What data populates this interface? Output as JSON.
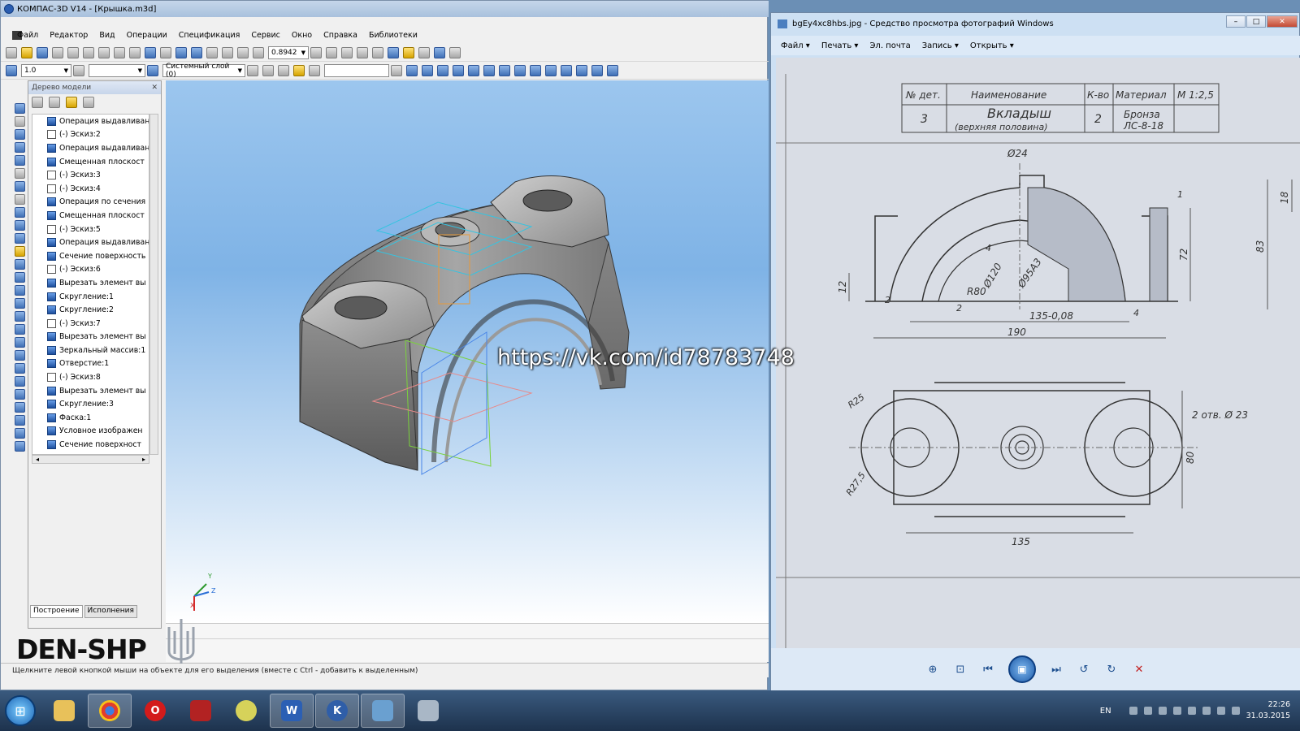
{
  "kompas": {
    "title": "КОМПАС-3D V14 - [Крышка.m3d]",
    "menu": [
      "Файл",
      "Редактор",
      "Вид",
      "Операции",
      "Спецификация",
      "Сервис",
      "Окно",
      "Справка",
      "Библиотеки"
    ],
    "zoom": "0.8942",
    "step": "1.0",
    "layer": "Системный слой (0)",
    "tree_title": "Дерево модели",
    "tree": [
      {
        "label": "Операция выдавливан",
        "type": "op"
      },
      {
        "label": "(-) Эскиз:2",
        "type": "sketch"
      },
      {
        "label": "Операция выдавливан",
        "type": "op"
      },
      {
        "label": "Смещенная плоскост",
        "type": "op"
      },
      {
        "label": "(-) Эскиз:3",
        "type": "sketch"
      },
      {
        "label": "(-) Эскиз:4",
        "type": "sketch"
      },
      {
        "label": "Операция по сечения",
        "type": "op"
      },
      {
        "label": "Смещенная плоскост",
        "type": "op"
      },
      {
        "label": "(-) Эскиз:5",
        "type": "sketch"
      },
      {
        "label": "Операция выдавливан",
        "type": "op"
      },
      {
        "label": "Сечение поверхность",
        "type": "op"
      },
      {
        "label": "(-) Эскиз:6",
        "type": "sketch"
      },
      {
        "label": "Вырезать элемент вы",
        "type": "op"
      },
      {
        "label": "Скругление:1",
        "type": "op"
      },
      {
        "label": "Скругление:2",
        "type": "op"
      },
      {
        "label": "(-) Эскиз:7",
        "type": "sketch"
      },
      {
        "label": "Вырезать элемент вы",
        "type": "op"
      },
      {
        "label": "Зеркальный массив:1",
        "type": "op"
      },
      {
        "label": "Отверстие:1",
        "type": "op"
      },
      {
        "label": "(-) Эскиз:8",
        "type": "sketch"
      },
      {
        "label": "Вырезать элемент вы",
        "type": "op"
      },
      {
        "label": "Скругление:3",
        "type": "op"
      },
      {
        "label": "Фаска:1",
        "type": "op"
      },
      {
        "label": "Условное изображен",
        "type": "op"
      },
      {
        "label": "Сечение поверхност",
        "type": "op"
      }
    ],
    "tabs": [
      "Построение",
      "Исполнения"
    ],
    "status": "Щелкните левой кнопкой мыши на объекте для его выделения (вместе с Ctrl - добавить к выделенным)",
    "axes": {
      "y": "Y",
      "z": "Z",
      "x": "X"
    }
  },
  "viewer": {
    "title": "bgEy4xc8hbs.jpg - Средство просмотра фотографий Windows",
    "menu": [
      "Файл ▾",
      "Печать ▾",
      "Эл. почта",
      "Запись ▾",
      "Открыть ▾"
    ],
    "table_headers": [
      "№ дет.",
      "Наименование",
      "К-во",
      "Материал",
      "М 1:2,5"
    ],
    "table_row": [
      "3",
      "Вкладыш",
      "2",
      "Бронза"
    ],
    "table_row2": [
      "(верхняя половина)",
      "ЛС-8-18"
    ],
    "dims": {
      "d24": "Ø24",
      "d120": "Ø120",
      "d95": "Ø95A3",
      "r80": "R80",
      "r4": "4",
      "d72": "72",
      "d83": "83",
      "d18": "18",
      "d12": "12",
      "d135a": "135-0,08",
      "d190": "190",
      "d2a": "2",
      "d2b": "2",
      "d4": "4",
      "d1": "1",
      "r25": "R25",
      "r275": "R27,5",
      "holes": "2 отв. Ø 23",
      "d80": "80",
      "d135b": "135"
    }
  },
  "overlay": {
    "url": "https://vk.com/id78783748",
    "logo": "DEN-SHP"
  },
  "taskbar": {
    "lang": "EN",
    "time": "22:26",
    "date": "31.03.2015",
    "apps": [
      "explorer",
      "chrome",
      "opera",
      "app-red",
      "app-lemon",
      "word",
      "kompas",
      "photo-viewer",
      "calculator"
    ]
  }
}
